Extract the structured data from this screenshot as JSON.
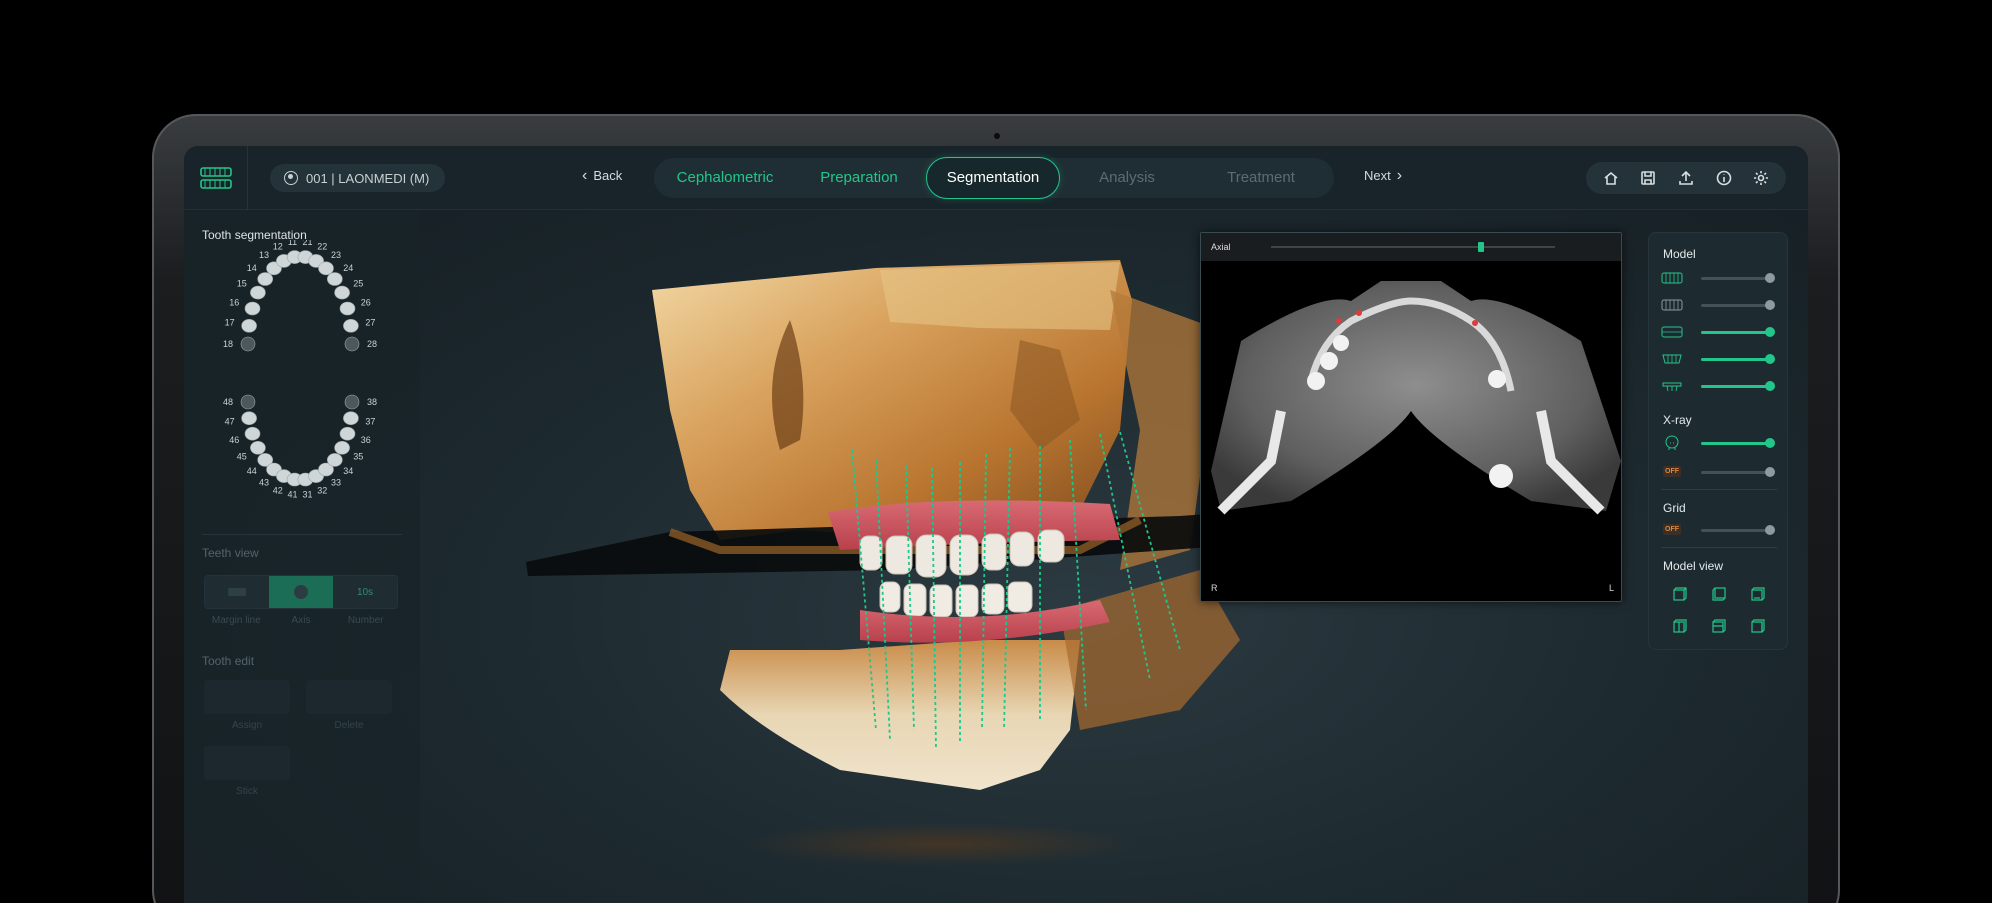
{
  "header": {
    "patient": "001 | LAONMEDI (M)",
    "back_label": "Back",
    "next_label": "Next",
    "steps": [
      {
        "label": "Cephalometric",
        "state": "done"
      },
      {
        "label": "Preparation",
        "state": "done"
      },
      {
        "label": "Segmentation",
        "state": "active"
      },
      {
        "label": "Analysis",
        "state": "pending"
      },
      {
        "label": "Treatment",
        "state": "pending"
      }
    ],
    "tools": [
      "home-icon",
      "save-icon",
      "upload-icon",
      "info-icon",
      "settings-icon"
    ]
  },
  "left": {
    "tooth_segmentation_title": "Tooth segmentation",
    "upper_teeth": [
      "18",
      "17",
      "16",
      "15",
      "14",
      "13",
      "12",
      "11",
      "21",
      "22",
      "23",
      "24",
      "25",
      "26",
      "27",
      "28"
    ],
    "lower_teeth": [
      "48",
      "47",
      "46",
      "45",
      "44",
      "43",
      "42",
      "41",
      "31",
      "32",
      "33",
      "34",
      "35",
      "36",
      "37",
      "38"
    ],
    "teeth_view_title": "Teeth view",
    "teeth_view_options": [
      "Margin line",
      "Axis",
      "Number"
    ],
    "teeth_view_selected": "Axis",
    "number_button_text": "10s",
    "tooth_edit_title": "Tooth edit",
    "tooth_edit_options": [
      "Assign",
      "Delete",
      "Stick"
    ]
  },
  "axial": {
    "label": "Axial",
    "slider_value": 0.74,
    "corner_left": "R",
    "corner_right": "L"
  },
  "right": {
    "model_title": "Model",
    "model_sliders": [
      {
        "on": false,
        "value": 0.95
      },
      {
        "on": false,
        "value": 0.95
      },
      {
        "on": true,
        "value": 0.95
      },
      {
        "on": true,
        "value": 0.95
      },
      {
        "on": true,
        "value": 0.95
      }
    ],
    "xray_title": "X-ray",
    "xray_sliders": [
      {
        "icon": "skull-icon",
        "on": true,
        "value": 0.95
      },
      {
        "icon": "off",
        "on": false,
        "value": 0.95
      }
    ],
    "grid_title": "Grid",
    "grid_off_label": "OFF",
    "model_view_title": "Model view"
  },
  "colors": {
    "accent": "#22c68a",
    "background": "#18242a",
    "off_badge": "#e0863a"
  }
}
